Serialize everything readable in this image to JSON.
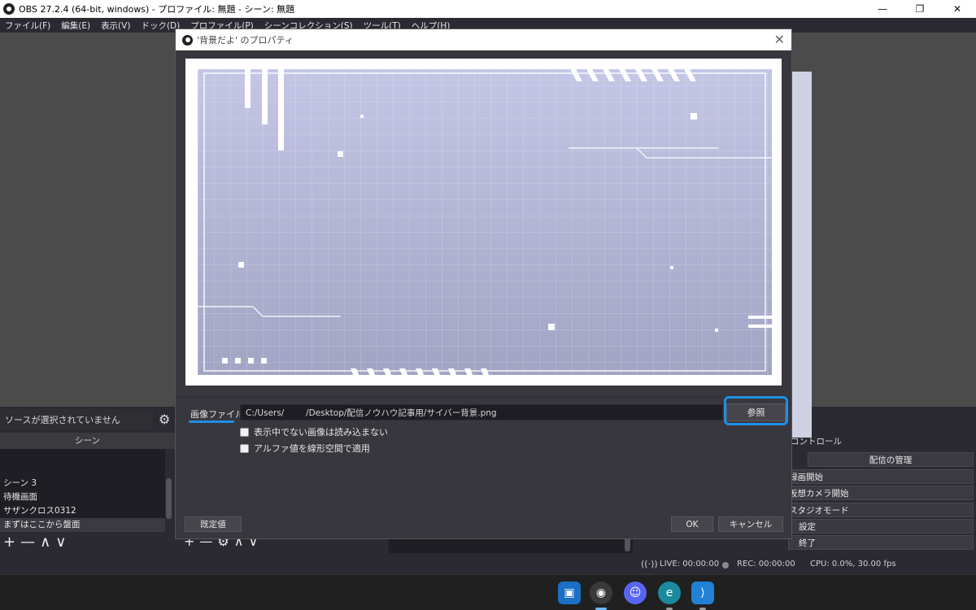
{
  "window": {
    "title": "OBS 27.2.4 (64-bit, windows) - プロファイル: 無題 - シーン: 無題",
    "minimize": "—",
    "maximize": "❐",
    "close": "✕"
  },
  "menu": [
    "ファイル(F)",
    "編集(E)",
    "表示(V)",
    "ドック(D)",
    "プロファイル(P)",
    "シーンコレクション(S)",
    "ツール(T)",
    "ヘルプ(H)"
  ],
  "sources_panel": {
    "status": "ソースが選択されていません"
  },
  "scenes_panel": {
    "header": "シーン",
    "items": [
      "シーン 3",
      "待機画面",
      "サザンクロス0312",
      "まずはここから盤面"
    ],
    "selected_index": 3
  },
  "tool_glyphs": {
    "add": "+",
    "remove": "—",
    "up": "∧",
    "down": "∨",
    "gear": "⚙"
  },
  "controls_panel": {
    "header": "コントロール",
    "manage_stream": "配信の管理",
    "start_recording": "録画開始",
    "start_virtualcam": "仮想カメラ開始",
    "studio_mode": "スタジオモード",
    "settings": "設定",
    "exit": "終了"
  },
  "status_bar": {
    "live": "LIVE: 00:00:00",
    "rec": "REC: 00:00:00",
    "cpu": "CPU: 0.0%, 30.00 fps"
  },
  "dialog": {
    "title": "'背景だよ' のプロパティ",
    "close": "✕",
    "image_file_label": "画像ファイル",
    "image_file_value": "C:/Users/        /Desktop/配信ノウハウ記事用/サイバー背景.png",
    "browse": "参照",
    "option_unload": "表示中でない画像は読み込まない",
    "option_linear_alpha": "アルファ値を線形空間で適用",
    "defaults": "既定値",
    "ok": "OK",
    "cancel": "キャンセル"
  },
  "taskbar": {
    "apps": [
      {
        "name": "camera-app-icon",
        "glyph": "▣",
        "color": "#1b6fc4",
        "active": false
      },
      {
        "name": "obs-app-icon",
        "glyph": "◉",
        "color": "#3a3a3a",
        "active": true
      },
      {
        "name": "discord-app-icon",
        "glyph": "☺",
        "color": "#5865f2",
        "active": false
      },
      {
        "name": "edge-app-icon",
        "glyph": "e",
        "color": "#1c8a9e",
        "active": false
      },
      {
        "name": "vscode-app-icon",
        "glyph": "⟩",
        "color": "#1f82d4",
        "active": false
      }
    ]
  },
  "colors": {
    "accent_highlight": "#1e8fe6",
    "dialog_bg": "#38373d",
    "panel_bg": "#2b2a33",
    "preview_gradient_top": "#c4c6e6",
    "preview_gradient_bottom": "#a2a4c4"
  }
}
